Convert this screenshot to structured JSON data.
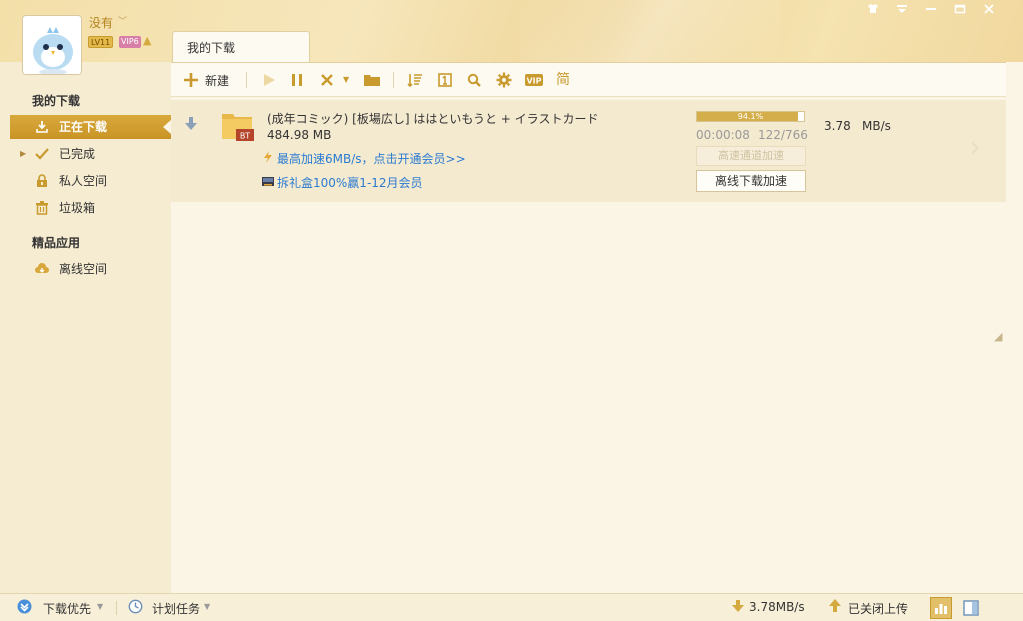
{
  "user": {
    "name": "没有",
    "level_badge": "LV11",
    "vip_badge": "VIP6"
  },
  "tabs": {
    "my_downloads": "我的下载"
  },
  "window_controls": [
    "shirt-icon",
    "menu-icon",
    "minimize-icon",
    "maximize-icon",
    "close-icon"
  ],
  "sidebar": {
    "section1": "我的下载",
    "items": [
      {
        "label": "正在下载",
        "icon": "download-icon",
        "active": true
      },
      {
        "label": "已完成",
        "icon": "check-icon",
        "active": false
      },
      {
        "label": "私人空间",
        "icon": "lock-icon",
        "active": false
      },
      {
        "label": "垃圾箱",
        "icon": "trash-icon",
        "active": false
      }
    ],
    "section2": "精品应用",
    "apps": [
      {
        "label": "离线空间",
        "icon": "cloud-icon"
      }
    ]
  },
  "toolbar": {
    "new_label": "新建",
    "simplified_label": "简",
    "vip_label": "VIP"
  },
  "task": {
    "name": "(成年コミック) [板場広し] ははといもうと + イラストカード",
    "size": "484.98 MB",
    "badge": "BT",
    "promo1": "最高加速6MB/s，点击开通会员>>",
    "promo2": "拆礼盒100%赢1-12月会员",
    "progress_text": "94.1%",
    "progress": 0.941,
    "elapsed": "00:00:08",
    "pieces": "122/766",
    "speed": "3.78",
    "speed_unit": "MB/s",
    "btn_high_speed": "高速通道加速",
    "btn_offline": "离线下载加速"
  },
  "status": {
    "download_priority": "下载优先",
    "scheduled": "计划任务",
    "download_speed": "3.78MB/s",
    "upload": "已关闭上传"
  },
  "colors": {
    "accent": "#d4ae4a",
    "active_bg": "#c99425",
    "link": "#2b7bd1"
  }
}
